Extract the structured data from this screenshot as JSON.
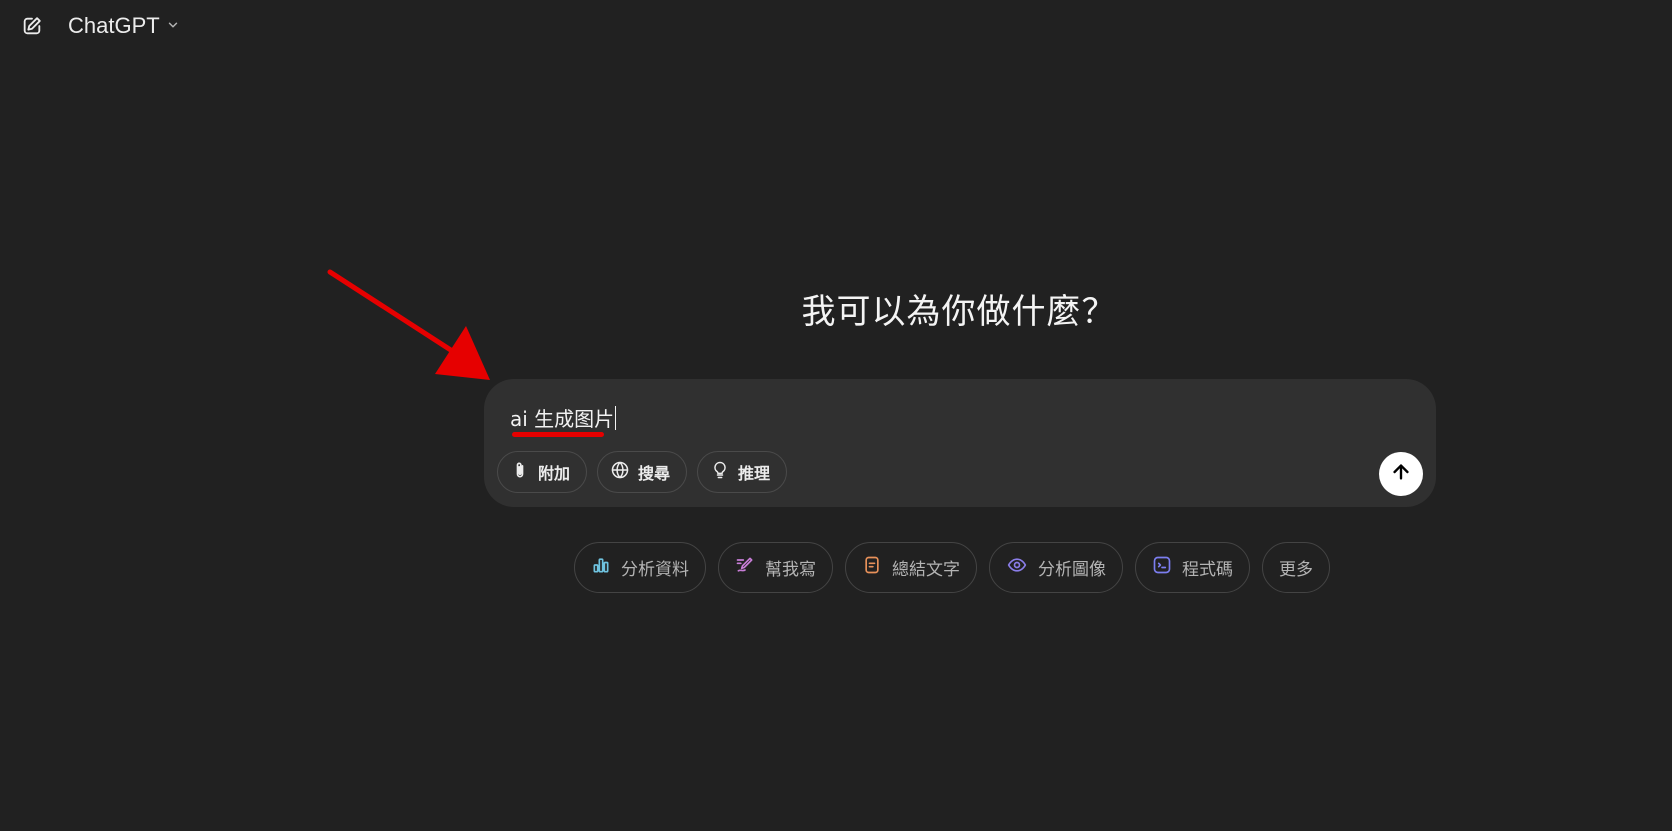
{
  "header": {
    "new_chat_icon": "edit-icon",
    "model_name": "ChatGPT",
    "model_dropdown_icon": "chevron-down-icon"
  },
  "main": {
    "heading": "我可以為你做什麼？"
  },
  "composer": {
    "input_value": "ai 生成图片",
    "tools": [
      {
        "label": "附加",
        "icon": "paperclip-icon"
      },
      {
        "label": "搜尋",
        "icon": "globe-icon"
      },
      {
        "label": "推理",
        "icon": "lightbulb-icon"
      }
    ],
    "send_icon": "arrow-up-icon"
  },
  "suggestions": [
    {
      "label": "分析資料",
      "icon": "bar-chart-icon",
      "color": "#6fc3df"
    },
    {
      "label": "幫我寫",
      "icon": "pen-icon",
      "color": "#c77dd6"
    },
    {
      "label": "總結文字",
      "icon": "document-icon",
      "color": "#e8915a"
    },
    {
      "label": "分析圖像",
      "icon": "eye-icon",
      "color": "#8a7de8"
    },
    {
      "label": "程式碼",
      "icon": "terminal-icon",
      "color": "#7c7ef0"
    },
    {
      "label": "更多",
      "icon": "",
      "color": "#b4b4b4"
    }
  ],
  "colors": {
    "background": "#212121",
    "composer": "#303030",
    "annotation": "#e60000"
  }
}
